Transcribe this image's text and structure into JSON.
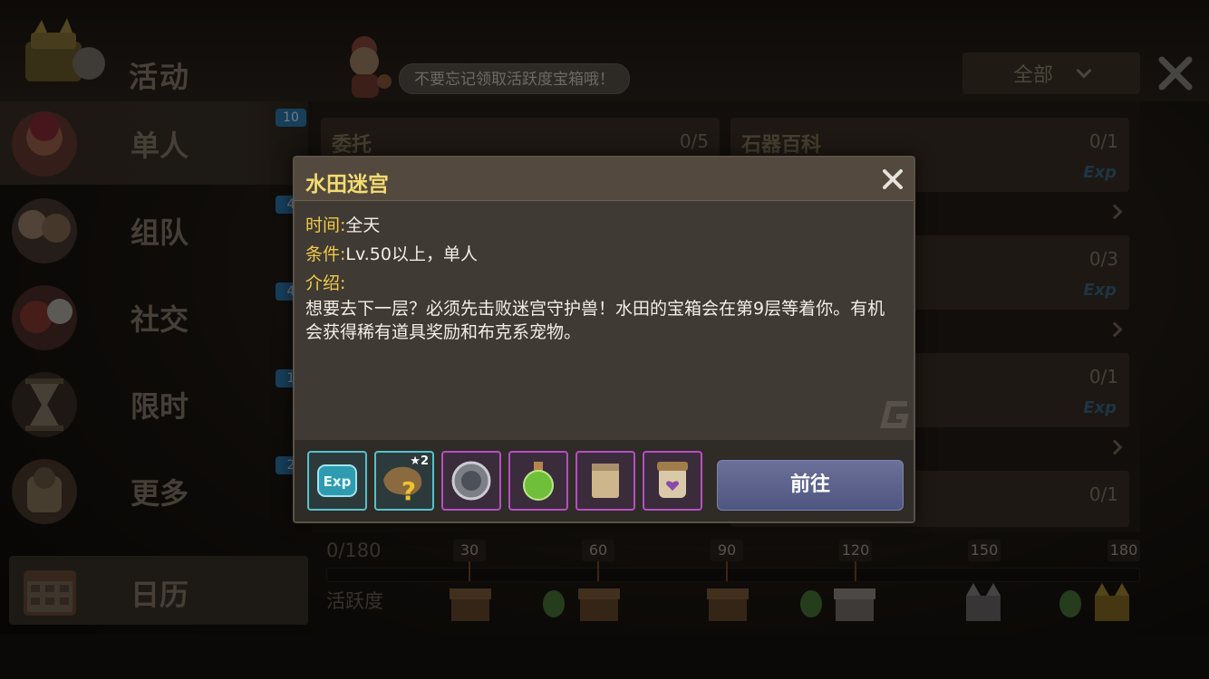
{
  "header": {
    "title": "活动",
    "tip": "不要忘记领取活跃度宝箱哦！",
    "filter_label": "全部"
  },
  "sidebar": {
    "items": [
      {
        "label": "单人",
        "badge": "10"
      },
      {
        "label": "组队",
        "badge": "4"
      },
      {
        "label": "社交",
        "badge": "4"
      },
      {
        "label": "限时",
        "badge": "1"
      },
      {
        "label": "更多",
        "badge": "2"
      }
    ],
    "calendar_label": "日历"
  },
  "cards": {
    "left_top": {
      "title": "委托",
      "count": "0/5"
    },
    "right": [
      {
        "title": "石器百科",
        "count": "0/1",
        "exp": "Exp"
      },
      {
        "count": "0/3",
        "exp": "Exp"
      },
      {
        "count": "0/1",
        "exp": "Exp"
      },
      {
        "count": "0/1"
      }
    ]
  },
  "activity": {
    "total": "0/180",
    "label": "活跃度",
    "milestones": [
      "30",
      "60",
      "90",
      "120",
      "150",
      "180"
    ],
    "progress": 0
  },
  "modal": {
    "title": "水田迷宫",
    "time_key": "时间:",
    "time_value": "全天",
    "cond_key": "条件:",
    "cond_value": "Lv.50以上，单人",
    "intro_key": "介绍:",
    "description": "想要去下一层？必须先击败迷宫守护兽！水田的宝箱会在第9层等着你。有机会获得稀有道具奖励和布克系宠物。",
    "rewards": [
      {
        "icon": "exp-icon",
        "rarity": "cyan"
      },
      {
        "icon": "mystery-pet-icon",
        "rarity": "cyan",
        "stars": "2"
      },
      {
        "icon": "badge-icon",
        "rarity": "purple"
      },
      {
        "icon": "potion-icon",
        "rarity": "purple"
      },
      {
        "icon": "scroll-icon",
        "rarity": "purple"
      },
      {
        "icon": "jar-icon",
        "rarity": "purple"
      }
    ],
    "go_label": "前往"
  },
  "colors": {
    "title_gold": "#f3dc72",
    "key_gold": "#f0c94a",
    "button_blue": "#5a6090",
    "badge_blue": "#2f7fb8"
  }
}
